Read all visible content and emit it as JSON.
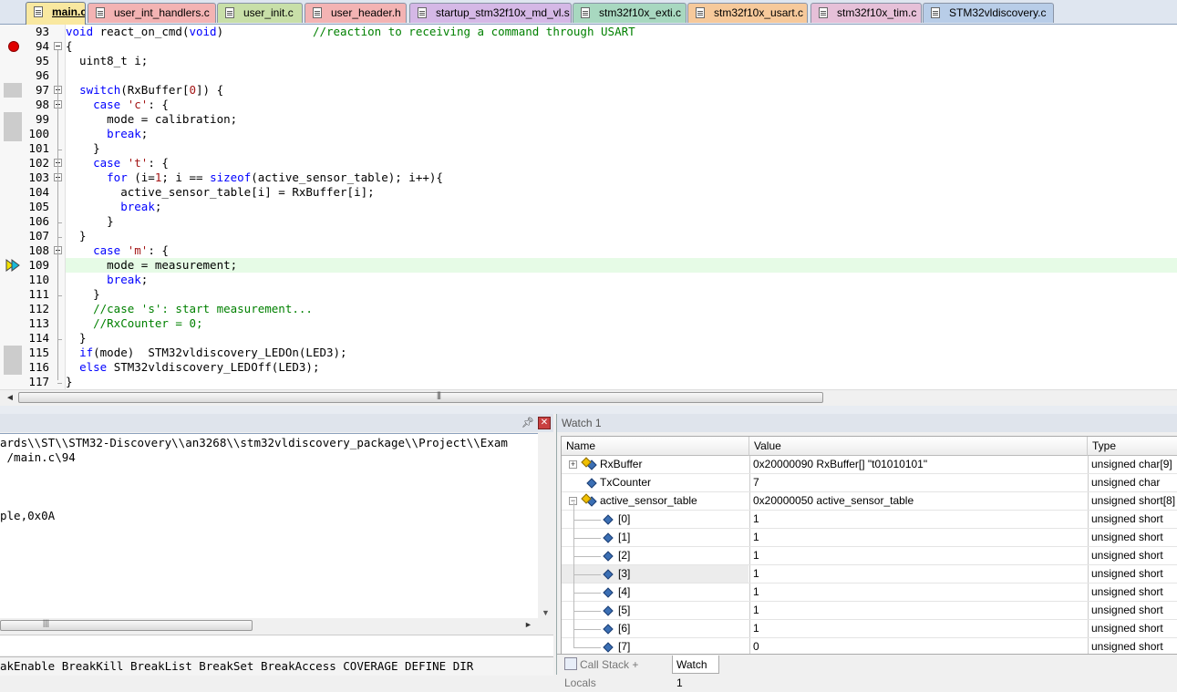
{
  "tabs": [
    {
      "label": "main.c",
      "color": "#f9e8a0",
      "active": true
    },
    {
      "label": "user_int_handlers.c",
      "color": "#f3b3b3"
    },
    {
      "label": "user_init.c",
      "color": "#c8dfa8"
    },
    {
      "label": "user_header.h",
      "color": "#f3b3b3"
    },
    {
      "label": "startup_stm32f10x_md_vl.s",
      "color": "#d5b8e6"
    },
    {
      "label": "stm32f10x_exti.c",
      "color": "#a8d8c0"
    },
    {
      "label": "stm32f10x_usart.c",
      "color": "#f6c99b"
    },
    {
      "label": "stm32f10x_tim.c",
      "color": "#e6c0d8"
    },
    {
      "label": "STM32vldiscovery.c",
      "color": "#b8cde8"
    }
  ],
  "editor": {
    "lines": [
      {
        "num": "93",
        "tokens": [
          [
            "kw",
            "void"
          ],
          [
            "t",
            " react_on_cmd("
          ],
          [
            "kw",
            "void"
          ],
          [
            "t",
            ")             "
          ],
          [
            "cm",
            "//reaction to receiving a command through USART"
          ]
        ]
      },
      {
        "num": "94",
        "tokens": [
          [
            "t",
            "{"
          ]
        ],
        "breakpoint": true,
        "fold": "open"
      },
      {
        "num": "95",
        "tokens": [
          [
            "t",
            "  uint8_t i;"
          ]
        ]
      },
      {
        "num": "96",
        "tokens": [
          [
            "t",
            ""
          ]
        ]
      },
      {
        "num": "97",
        "tokens": [
          [
            "t",
            "  "
          ],
          [
            "kw",
            "switch"
          ],
          [
            "t",
            "(RxBuffer["
          ],
          [
            "str",
            "0"
          ],
          [
            "t",
            "]) {"
          ]
        ],
        "cov": true,
        "fold": "open"
      },
      {
        "num": "98",
        "tokens": [
          [
            "t",
            "    "
          ],
          [
            "kw",
            "case"
          ],
          [
            "t",
            " "
          ],
          [
            "str",
            "'c'"
          ],
          [
            "t",
            ": {"
          ]
        ],
        "fold": "open"
      },
      {
        "num": "99",
        "tokens": [
          [
            "t",
            "      mode = calibration;"
          ]
        ],
        "cov": true
      },
      {
        "num": "100",
        "tokens": [
          [
            "t",
            "      "
          ],
          [
            "kw",
            "break"
          ],
          [
            "t",
            ";"
          ]
        ],
        "cov": true
      },
      {
        "num": "101",
        "tokens": [
          [
            "t",
            "    }"
          ]
        ],
        "fold": "end"
      },
      {
        "num": "102",
        "tokens": [
          [
            "t",
            "    "
          ],
          [
            "kw",
            "case"
          ],
          [
            "t",
            " "
          ],
          [
            "str",
            "'t'"
          ],
          [
            "t",
            ": {"
          ]
        ],
        "fold": "open"
      },
      {
        "num": "103",
        "tokens": [
          [
            "t",
            "      "
          ],
          [
            "kw",
            "for"
          ],
          [
            "t",
            " (i="
          ],
          [
            "str",
            "1"
          ],
          [
            "t",
            "; i == "
          ],
          [
            "kw",
            "sizeof"
          ],
          [
            "t",
            "(active_sensor_table); i++){"
          ]
        ],
        "fold": "open"
      },
      {
        "num": "104",
        "tokens": [
          [
            "t",
            "        active_sensor_table[i] = RxBuffer[i];"
          ]
        ]
      },
      {
        "num": "105",
        "tokens": [
          [
            "t",
            "        "
          ],
          [
            "kw",
            "break"
          ],
          [
            "t",
            ";"
          ]
        ]
      },
      {
        "num": "106",
        "tokens": [
          [
            "t",
            "      }"
          ]
        ],
        "fold": "end"
      },
      {
        "num": "107",
        "tokens": [
          [
            "t",
            "  }"
          ]
        ],
        "fold": "end"
      },
      {
        "num": "108",
        "tokens": [
          [
            "t",
            "    "
          ],
          [
            "kw",
            "case"
          ],
          [
            "t",
            " "
          ],
          [
            "str",
            "'m'"
          ],
          [
            "t",
            ": {"
          ]
        ],
        "fold": "open"
      },
      {
        "num": "109",
        "tokens": [
          [
            "t",
            "      mode = measurement;"
          ]
        ],
        "exec": true,
        "current": true
      },
      {
        "num": "110",
        "tokens": [
          [
            "t",
            "      "
          ],
          [
            "kw",
            "break"
          ],
          [
            "t",
            ";"
          ]
        ]
      },
      {
        "num": "111",
        "tokens": [
          [
            "t",
            "    }"
          ]
        ],
        "fold": "end"
      },
      {
        "num": "112",
        "tokens": [
          [
            "t",
            "    "
          ],
          [
            "cm",
            "//case 's': start measurement..."
          ]
        ]
      },
      {
        "num": "113",
        "tokens": [
          [
            "t",
            "    "
          ],
          [
            "cm",
            "//RxCounter = 0;"
          ]
        ]
      },
      {
        "num": "114",
        "tokens": [
          [
            "t",
            "  }"
          ]
        ],
        "fold": "end"
      },
      {
        "num": "115",
        "tokens": [
          [
            "t",
            "  "
          ],
          [
            "kw",
            "if"
          ],
          [
            "t",
            "(mode)  STM32vldiscovery_LEDOn(LED3);"
          ]
        ],
        "cov": true
      },
      {
        "num": "116",
        "tokens": [
          [
            "t",
            "  "
          ],
          [
            "kw",
            "else"
          ],
          [
            "t",
            " STM32vldiscovery_LEDOff(LED3);"
          ]
        ],
        "cov": true
      },
      {
        "num": "117",
        "tokens": [
          [
            "t",
            "}"
          ]
        ],
        "fold": "end"
      }
    ]
  },
  "command": {
    "output_lines": [
      "ards\\\\ST\\\\STM32-Discovery\\\\an3268\\\\stm32vldiscovery_package\\\\Project\\\\Exam",
      " /main.c\\94",
      "",
      "",
      "",
      "ple,0x0A"
    ],
    "keywords": "akEnable BreakKill BreakList BreakSet BreakAccess COVERAGE DEFINE DIR"
  },
  "watch": {
    "title": "Watch 1",
    "columns": {
      "name": "Name",
      "value": "Value",
      "type": "Type"
    },
    "rows": [
      {
        "name": "RxBuffer",
        "value": "0x20000090 RxBuffer[] \"t01010101\"",
        "type": "unsigned char[9]",
        "level": 0,
        "expander": "+",
        "icon": "struct"
      },
      {
        "name": "TxCounter",
        "value": "7",
        "type": "unsigned char",
        "level": 0,
        "icon": "var"
      },
      {
        "name": "active_sensor_table",
        "value": "0x20000050 active_sensor_table",
        "type": "unsigned short[8]",
        "level": 0,
        "expander": "-",
        "icon": "struct"
      },
      {
        "name": "[0]",
        "value": "1",
        "type": "unsigned short",
        "level": 1,
        "icon": "var"
      },
      {
        "name": "[1]",
        "value": "1",
        "type": "unsigned short",
        "level": 1,
        "icon": "var"
      },
      {
        "name": "[2]",
        "value": "1",
        "type": "unsigned short",
        "level": 1,
        "icon": "var"
      },
      {
        "name": "[3]",
        "value": "1",
        "type": "unsigned short",
        "level": 1,
        "icon": "var",
        "selected": true
      },
      {
        "name": "[4]",
        "value": "1",
        "type": "unsigned short",
        "level": 1,
        "icon": "var"
      },
      {
        "name": "[5]",
        "value": "1",
        "type": "unsigned short",
        "level": 1,
        "icon": "var"
      },
      {
        "name": "[6]",
        "value": "1",
        "type": "unsigned short",
        "level": 1,
        "icon": "var"
      },
      {
        "name": "[7]",
        "value": "0",
        "type": "unsigned short",
        "level": 1,
        "icon": "var"
      }
    ],
    "bottom_tabs": [
      {
        "label": "Call Stack + Locals",
        "active": false
      },
      {
        "label": "Watch 1",
        "active": true
      }
    ]
  }
}
